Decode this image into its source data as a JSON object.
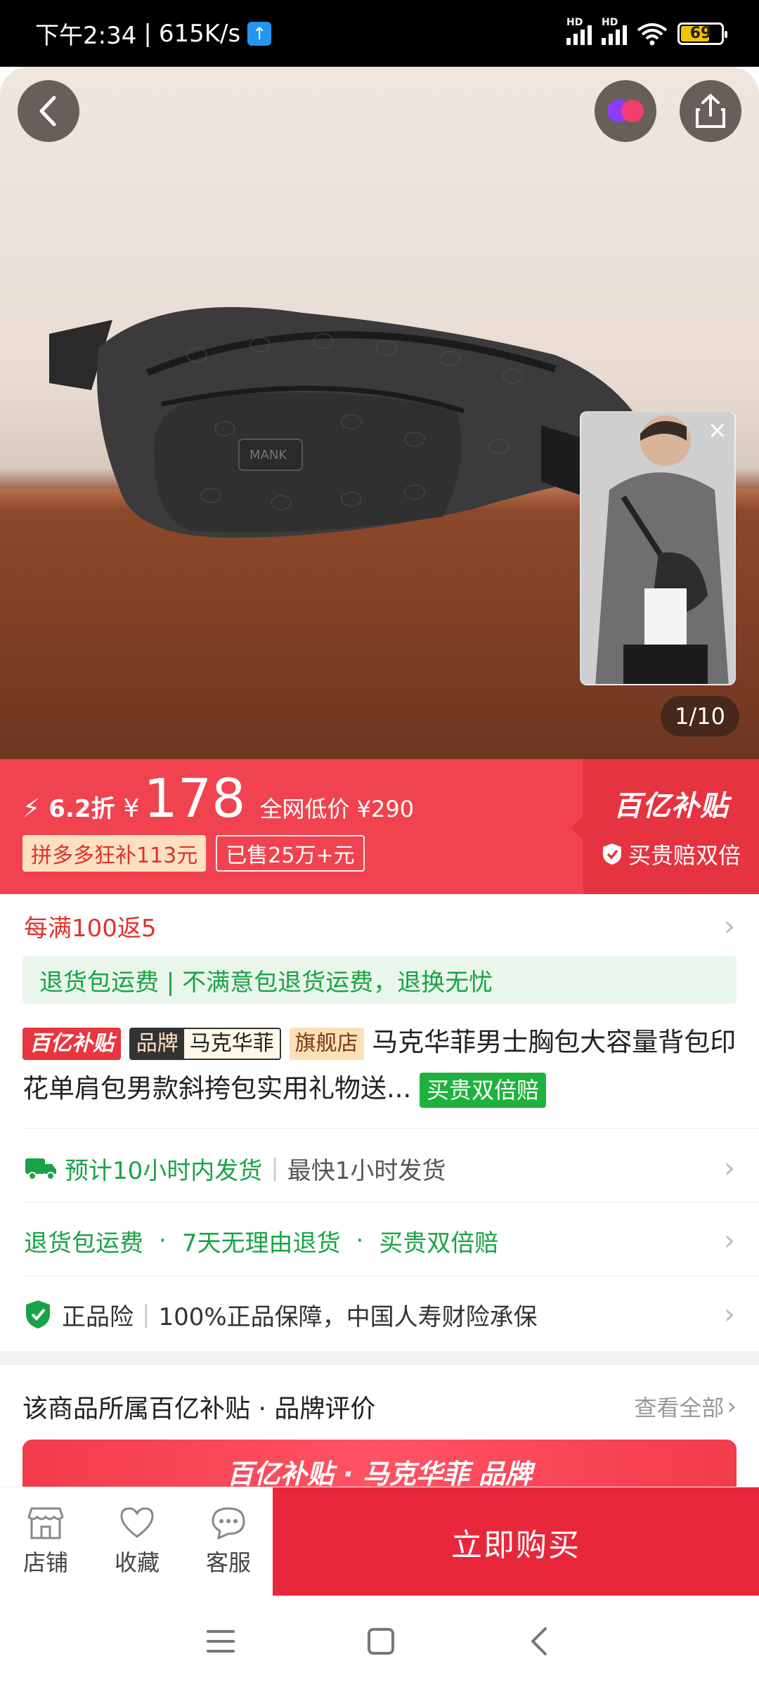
{
  "status_bar": {
    "time": "下午2:34",
    "speed": "615K/s",
    "upload_badge": "↑",
    "signal_label_1": "HD",
    "signal_label_2": "HD",
    "battery": "69"
  },
  "hero": {
    "page_indicator": "1/10",
    "close_glyph": "×"
  },
  "price": {
    "bolt": "⚡",
    "discount": "6.2折",
    "currency": "¥",
    "amount": "178",
    "lowest_text": "全网低价 ¥290",
    "subsidy_tag": "拼多多狂补113元",
    "sold_tag": "已售25万+元",
    "program_logo": "百亿补贴",
    "guarantee": "买贵赔双倍"
  },
  "rebate": {
    "text": "每满100返5"
  },
  "return_banner": {
    "text": "退货包运费 | 不满意包退货运费，退换无忧"
  },
  "title": {
    "badge_subsidy": "百亿补贴",
    "badge_brand_label": "品牌",
    "badge_brand_name": "马克华菲",
    "badge_flagship": "旗舰店",
    "text": "马克华菲男士胸包大容量背包印花单肩包男款斜挎包实用礼物送...",
    "badge_guarantee": "买贵双倍赔"
  },
  "shipping": {
    "estimate": "预计10小时内发货",
    "fastest": "最快1小时发货"
  },
  "services": {
    "item1": "退货包运费",
    "item2": "7天无理由退货",
    "item3": "买贵双倍赔",
    "dot": "·"
  },
  "authentic": {
    "label": "正品险",
    "text": "100%正品保障，中国人寿财险承保"
  },
  "rating_section": {
    "title": "该商品所属百亿补贴 · 品牌评价",
    "more": "查看全部",
    "strip_text": "百亿补贴 · 马克华菲 品牌"
  },
  "actions": {
    "shop": "店铺",
    "favorite": "收藏",
    "service": "客服",
    "buy": "立即购买"
  },
  "colors": {
    "accent_red": "#f0434f",
    "buy_red": "#e8283a",
    "green": "#1aa346"
  }
}
